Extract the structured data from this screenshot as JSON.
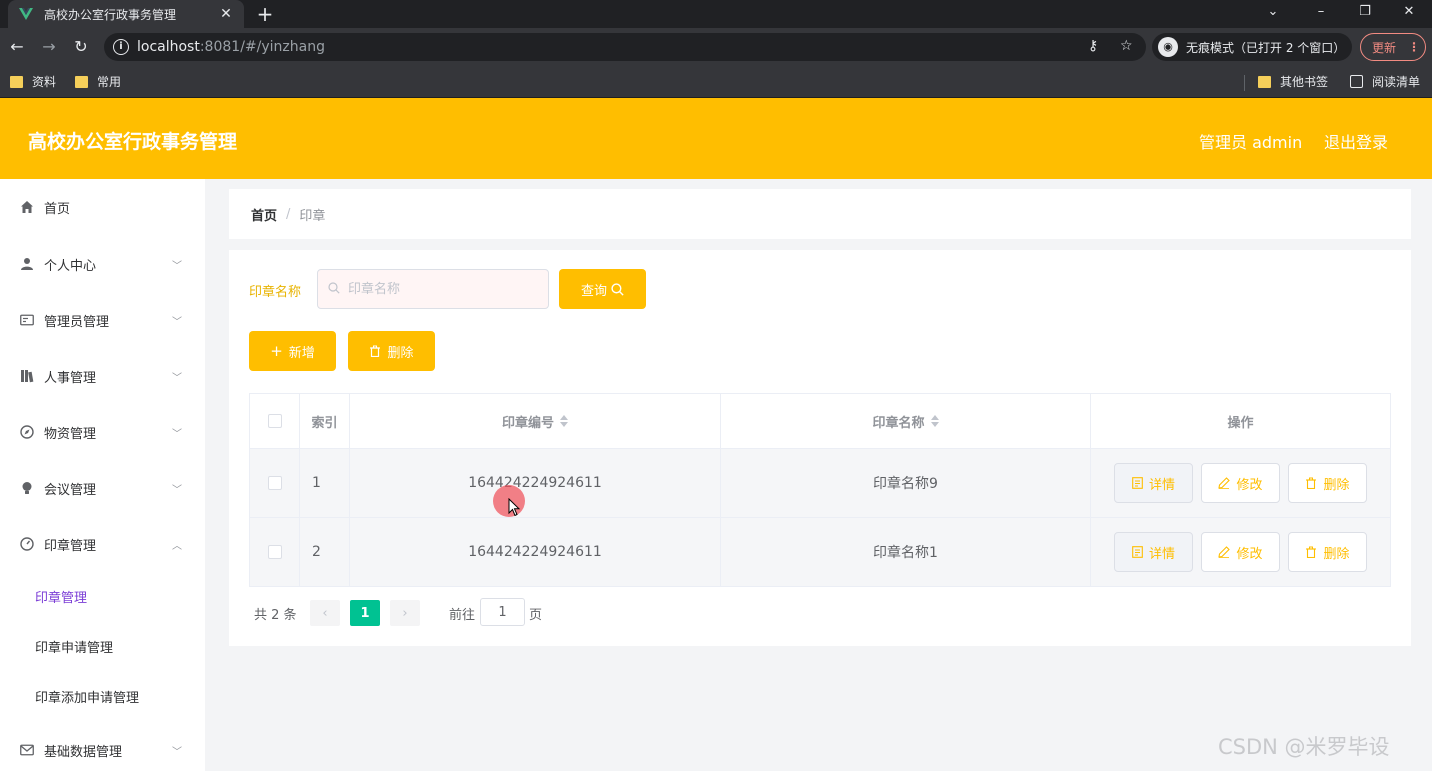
{
  "browser": {
    "tab_title": "高校办公室行政事务管理",
    "url_host": "localhost",
    "url_rest": ":8081/#/yinzhang",
    "incognito_text": "无痕模式（已打开 2 个窗口）",
    "update_label": "更新",
    "bookmarks": [
      "资料",
      "常用"
    ],
    "other_bookmarks": "其他书签",
    "reading_list": "阅读清单"
  },
  "header": {
    "title": "高校办公室行政事务管理",
    "user_label": "管理员 admin",
    "logout_label": "退出登录",
    "accent_color": "#ffbe00"
  },
  "sidebar": {
    "items": [
      {
        "label": "首页",
        "icon": "home-icon"
      },
      {
        "label": "个人中心",
        "icon": "user-icon"
      },
      {
        "label": "管理员管理",
        "icon": "postcard-icon"
      },
      {
        "label": "人事管理",
        "icon": "books-icon"
      },
      {
        "label": "物资管理",
        "icon": "compass-icon"
      },
      {
        "label": "会议管理",
        "icon": "bulb-icon"
      },
      {
        "label": "印章管理",
        "icon": "stopwatch-icon"
      }
    ],
    "submenu": [
      {
        "label": "印章管理",
        "active": true
      },
      {
        "label": "印章申请管理"
      },
      {
        "label": "印章添加申请管理"
      }
    ],
    "last_item": {
      "label": "基础数据管理",
      "icon": "message-icon"
    },
    "active_color": "#7b3dd6"
  },
  "breadcrumb": {
    "home": "首页",
    "separator": "/",
    "current": "印章"
  },
  "search": {
    "label": "印章名称",
    "placeholder": "印章名称",
    "query_button": "查询"
  },
  "actions": {
    "add_label": "新增",
    "delete_label": "删除"
  },
  "table": {
    "headers": [
      "索引",
      "印章编号",
      "印章名称",
      "操作"
    ],
    "rows": [
      {
        "index": "1",
        "code": "164424224924611",
        "name": "印章名称9"
      },
      {
        "index": "2",
        "code": "164424224924611",
        "name": "印章名称1"
      }
    ],
    "row_actions": {
      "detail": "详情",
      "edit": "修改",
      "delete": "删除"
    }
  },
  "pagination": {
    "total_text": "共 2 条",
    "current_page": "1",
    "goto_label": "前往",
    "goto_value": "1",
    "page_unit": "页",
    "active_color": "#00c292"
  },
  "watermark": "CSDN @米罗毕设"
}
